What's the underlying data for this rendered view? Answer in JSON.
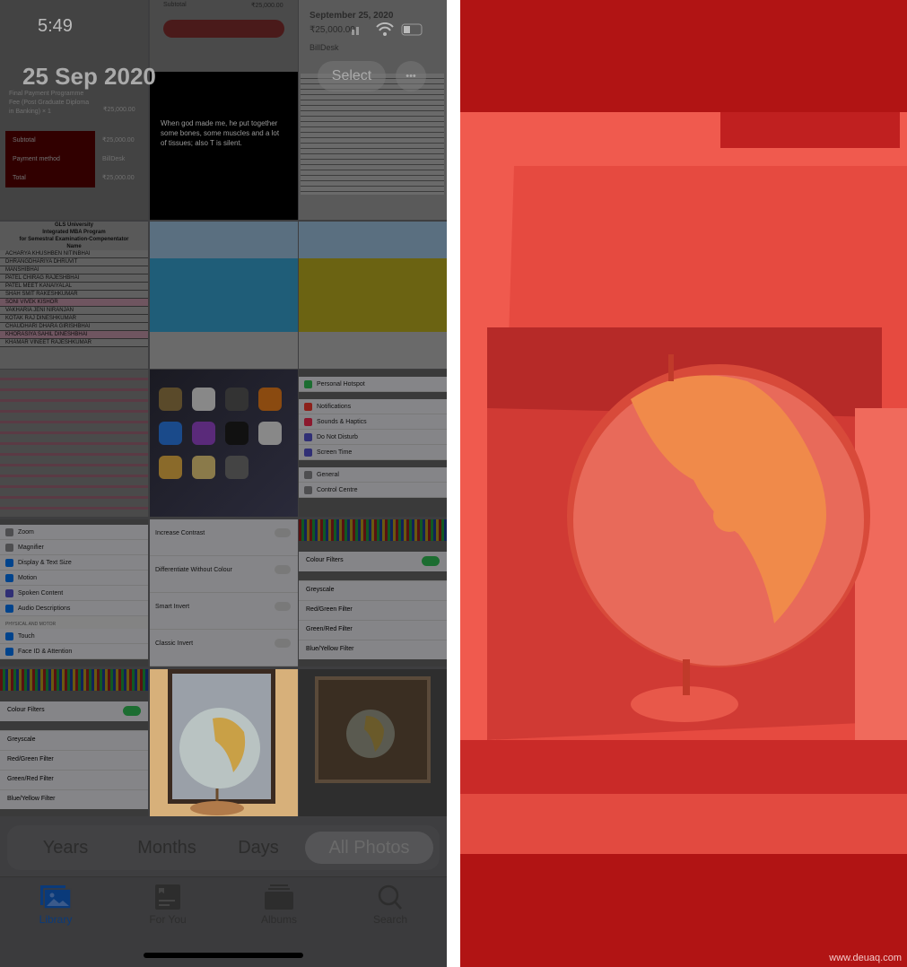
{
  "status_bar": {
    "time": "5:49"
  },
  "header": {
    "date": "25 Sep 2020",
    "select_label": "Select",
    "more_label": "•••"
  },
  "thumbnails": {
    "receipt": {
      "items": "Final Payment Programme Fee (Post Graduate Diploma in Banking) × 1",
      "item_amount": "₹25,000.00",
      "subtotal_label": "Subtotal",
      "subtotal": "₹25,000.00",
      "payment_label": "Payment method",
      "payment": "BillDesk",
      "total_label": "Total",
      "total": "₹25,000.00"
    },
    "receipt_top": {
      "subtotal_label": "Subtotal",
      "subtotal": "₹25,000.00",
      "date": "September 25, 2020",
      "amount": "₹25,000.00",
      "payment": "BillDesk"
    },
    "quote": "When god made me, he put together some bones, some muscles and a lot of tissues; also T is silent.",
    "sheet": {
      "university": "GLS University",
      "program": "Integrated MBA Program",
      "title": "for Semestral Examination-Compenentator",
      "name_header": "Name",
      "names": [
        "ACHARYA KHUSHBEN NITINBHAI",
        "DHRANGDHARIYA DHRUVIT",
        "MANSHIBHAI",
        "PATEL CHIRAG RAJESHBHAI",
        "PATEL MEET KANAIYALAL",
        "SHAH SMIT RAKESHKUMAR",
        "SONI VIVEK KISHOR",
        "VAKHARIA JENI NIRANJAN",
        "KOTAK RAJ DINESHKUMAR",
        "CHAUDHARI DHARA GIRISHBHAI",
        "KHORASIYA SAHIL DINESHBHAI",
        "KHAMAR VINEET RAJESHKUMAR"
      ]
    },
    "settings_a": [
      "Zoom",
      "Magnifier",
      "Display & Text Size",
      "Motion",
      "Spoken Content",
      "Audio Descriptions"
    ],
    "settings_a_section": "PHYSICAL AND MOTOR",
    "settings_a2": [
      "Touch",
      "Face ID & Attention"
    ],
    "settings_b": [
      "Increase Contrast",
      "Differentiate Without Colour",
      "Smart Invert",
      "Classic Invert"
    ],
    "settings_c": [
      "Personal Hotspot",
      "Notifications",
      "Sounds & Haptics",
      "Do Not Disturb",
      "Screen Time",
      "General",
      "Control Centre"
    ],
    "filters": {
      "toggle_label": "Colour Filters",
      "options": [
        "Greyscale",
        "Red/Green Filter",
        "Green/Red Filter",
        "Blue/Yellow Filter"
      ]
    }
  },
  "view_switcher": {
    "options": [
      "Years",
      "Months",
      "Days",
      "All Photos"
    ],
    "selected": "All Photos"
  },
  "tab_bar": {
    "items": [
      {
        "label": "Library",
        "icon": "photo-library-icon",
        "active": true
      },
      {
        "label": "For You",
        "icon": "for-you-icon"
      },
      {
        "label": "Albums",
        "icon": "albums-icon"
      },
      {
        "label": "Search",
        "icon": "search-icon"
      }
    ]
  },
  "colors": {
    "accent": "#0a3a7a",
    "filter_red": "#e0423a",
    "frame_red": "#b11414"
  },
  "watermark": "www.deuaq.com"
}
